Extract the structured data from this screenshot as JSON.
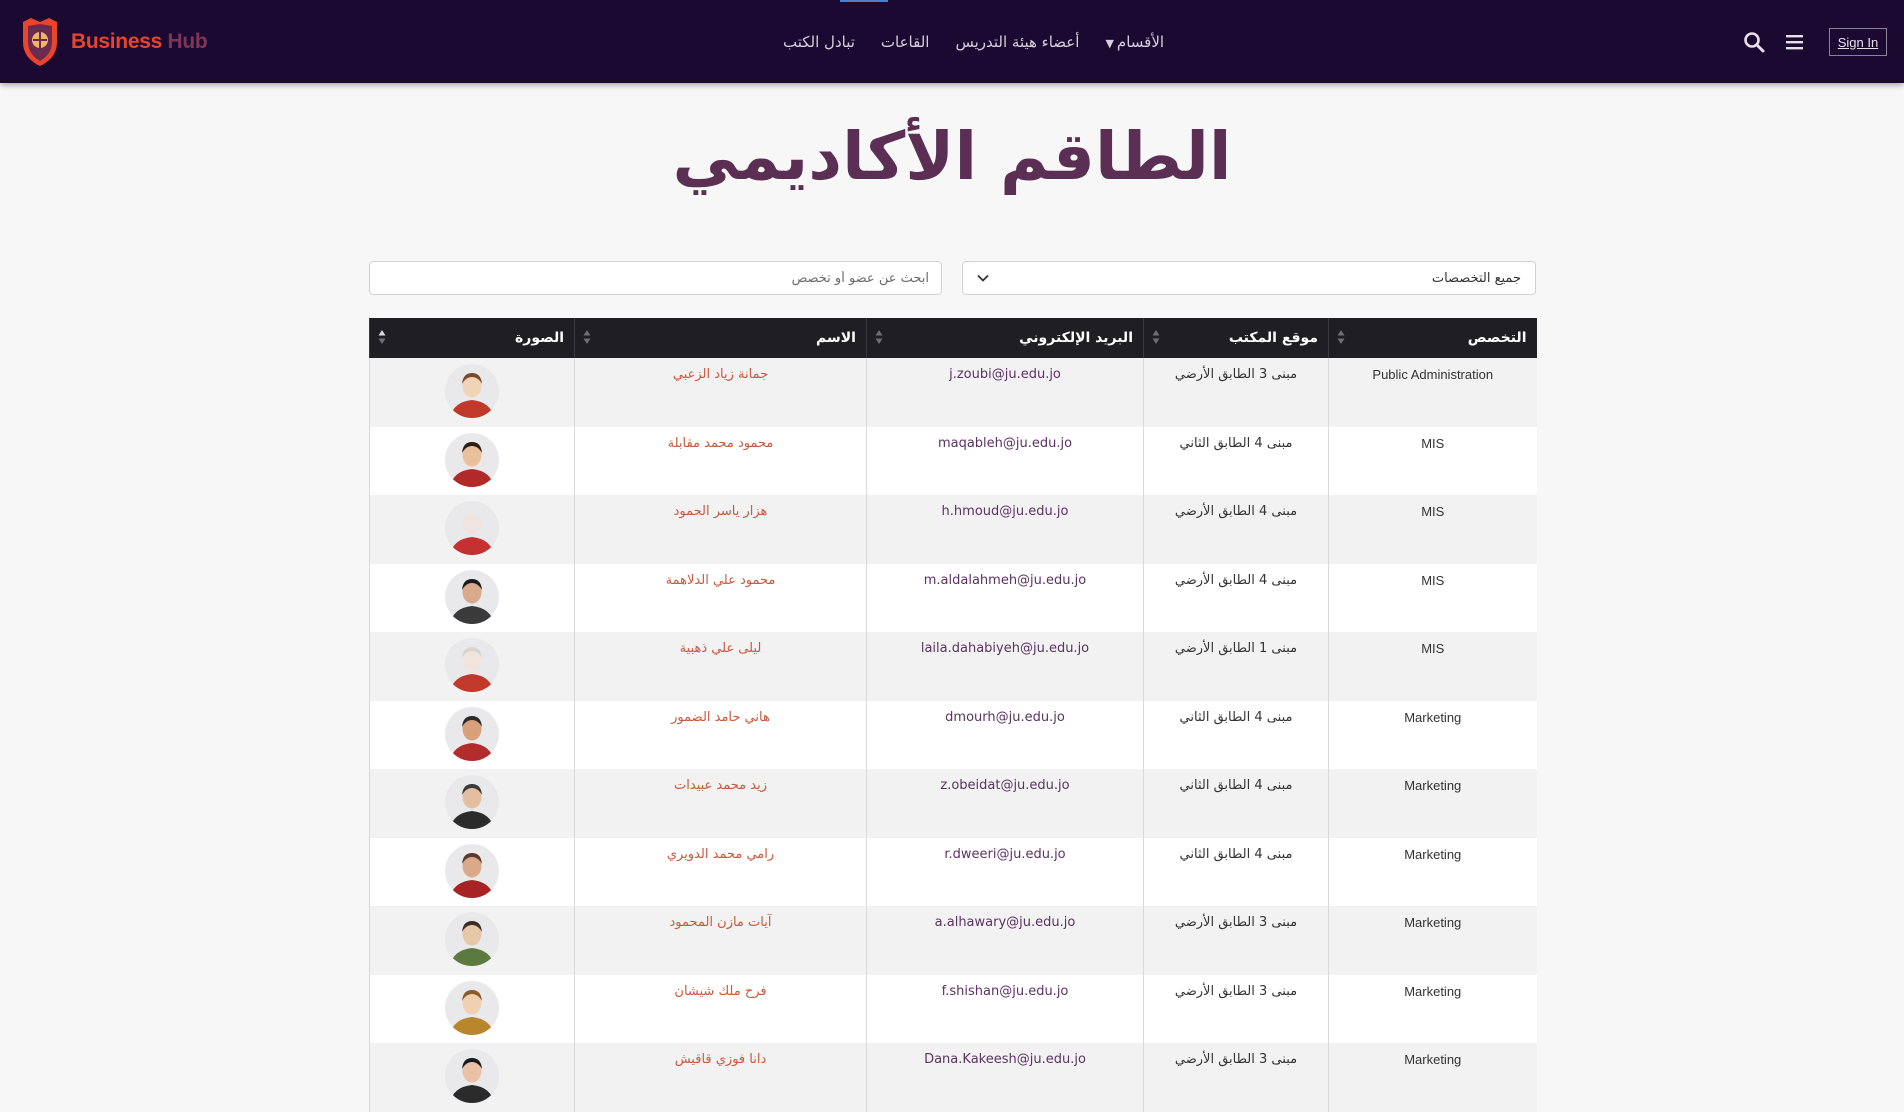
{
  "brand": {
    "part1": "Business",
    "part2": " Hub"
  },
  "nav": {
    "items": [
      {
        "label": "الأقسام",
        "has_caret": true
      },
      {
        "label": "أعضاء هيئة التدريس"
      },
      {
        "label": "القاعات"
      },
      {
        "label": "تبادل الكتب"
      }
    ],
    "sign_in": "Sign In"
  },
  "page": {
    "title": "الطاقم الأكاديمي"
  },
  "filters": {
    "search_placeholder": "ابحث عن عضو أو تخصص",
    "select_value": "جميع التخصصات"
  },
  "table": {
    "headers": {
      "specialization": "التخصص",
      "office": "موقع المكتب",
      "email": "البريد الإلكتروني",
      "name": "الاسم",
      "photo": "الصورة"
    },
    "rows": [
      {
        "specialization": "Public Administration",
        "office": "مبنى 3 الطابق الأرضي",
        "email": "j.zoubi@ju.edu.jo",
        "name": "جمانة زياد الزعبي"
      },
      {
        "specialization": "MIS",
        "office": "مبنى 4 الطابق الثاني",
        "email": "maqableh@ju.edu.jo",
        "name": "محمود محمد مقابلة"
      },
      {
        "specialization": "MIS",
        "office": "مبنى 4 الطابق الأرضي",
        "email": "h.hmoud@ju.edu.jo",
        "name": "هزار ياسر الحمود"
      },
      {
        "specialization": "MIS",
        "office": "مبنى 4 الطابق الأرضي",
        "email": "m.aldalahmeh@ju.edu.jo",
        "name": "محمود علي الدلاهمة"
      },
      {
        "specialization": "MIS",
        "office": "مبنى 1 الطابق الأرضي",
        "email": "laila.dahabiyeh@ju.edu.jo",
        "name": "ليلى علي ذهبية"
      },
      {
        "specialization": "Marketing",
        "office": "مبنى 4 الطابق الثاني",
        "email": "dmourh@ju.edu.jo",
        "name": "هاني حامد الضمور"
      },
      {
        "specialization": "Marketing",
        "office": "مبنى 4 الطابق الثاني",
        "email": "z.obeidat@ju.edu.jo",
        "name": "زيد محمد عبيدات"
      },
      {
        "specialization": "Marketing",
        "office": "مبنى 4 الطابق الثاني",
        "email": "r.dweeri@ju.edu.jo",
        "name": "رامي محمد الدويري"
      },
      {
        "specialization": "Marketing",
        "office": "مبنى 3 الطابق الأرضي",
        "email": "a.alhawary@ju.edu.jo",
        "name": "آيات مازن المحمود"
      },
      {
        "specialization": "Marketing",
        "office": "مبنى 3 الطابق الأرضي",
        "email": "f.shishan@ju.edu.jo",
        "name": "فرح ملك شيشان"
      },
      {
        "specialization": "Marketing",
        "office": "مبنى 3 الطابق الأرضي",
        "email": "Dana.Kakeesh@ju.edu.jo",
        "name": "دانا فوزي قاقيش"
      }
    ]
  },
  "colors": {
    "navbar": "#1c0932",
    "brand_accent": "#e8452c",
    "title": "#5b2f53",
    "name_link": "#c9583e",
    "email_link": "#5b3262",
    "table_header": "#1f1f23"
  }
}
